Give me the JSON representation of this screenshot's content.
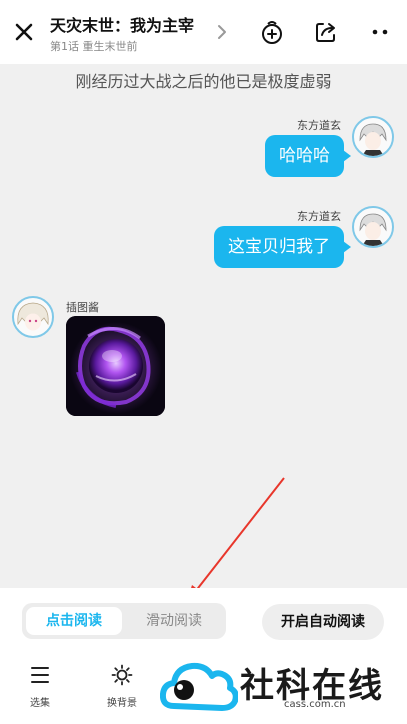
{
  "header": {
    "title": "天灾末世：我为主宰",
    "subtitle": "第1话 重生末世前"
  },
  "chat": {
    "narration": "刚经历过大战之后的他已是极度虚弱",
    "messages": [
      {
        "speaker": "东方道玄",
        "text": "哈哈哈"
      },
      {
        "speaker": "东方道玄",
        "text": "这宝贝归我了"
      },
      {
        "speaker": "插图酱",
        "text": ""
      }
    ]
  },
  "read_mode": {
    "click_read": "点击阅读",
    "scroll_read": "滑动阅读",
    "auto_read": "开启自动阅读"
  },
  "bottom_nav": [
    {
      "label": "选集"
    },
    {
      "label": "换背景"
    }
  ],
  "watermark": {
    "text": "社科在线",
    "url": "cass.com.cn"
  },
  "colors": {
    "accent": "#1bb6ee",
    "arrow": "#e8362b",
    "background": "#f0f0f0"
  }
}
